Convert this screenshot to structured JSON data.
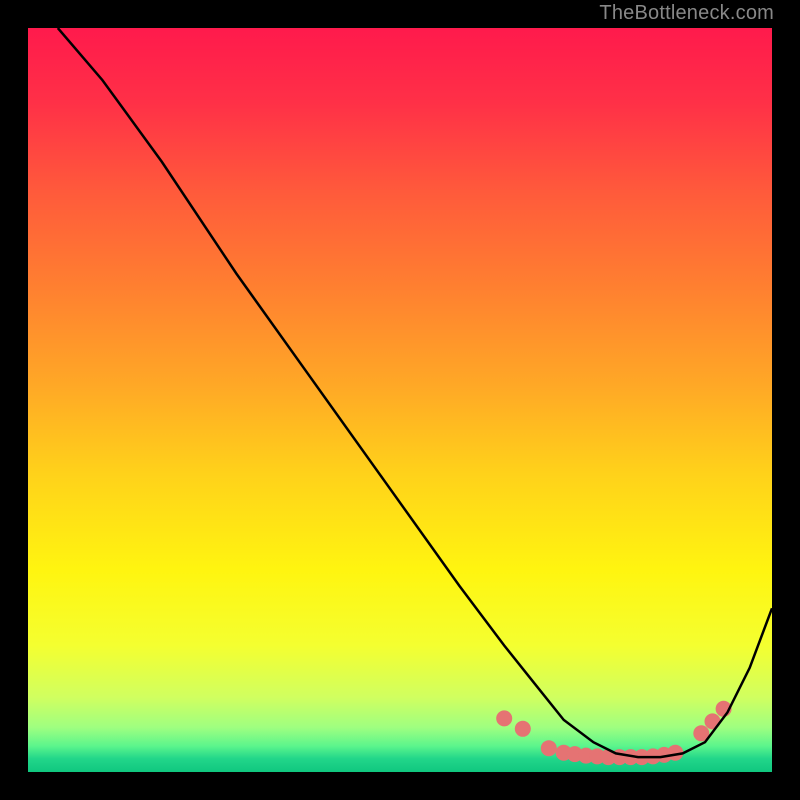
{
  "watermark": "TheBottleneck.com",
  "chart_data": {
    "type": "line",
    "title": "",
    "xlabel": "",
    "ylabel": "",
    "xlim": [
      0,
      100
    ],
    "ylim": [
      0,
      100
    ],
    "background": {
      "type": "vertical-gradient",
      "stops": [
        {
          "pos": 0.0,
          "color": "#ff1a4c"
        },
        {
          "pos": 0.1,
          "color": "#ff3047"
        },
        {
          "pos": 0.22,
          "color": "#ff5a3b"
        },
        {
          "pos": 0.35,
          "color": "#ff8030"
        },
        {
          "pos": 0.48,
          "color": "#ffa826"
        },
        {
          "pos": 0.6,
          "color": "#ffd21a"
        },
        {
          "pos": 0.73,
          "color": "#fff510"
        },
        {
          "pos": 0.83,
          "color": "#f4ff30"
        },
        {
          "pos": 0.9,
          "color": "#d0ff60"
        },
        {
          "pos": 0.94,
          "color": "#9fff80"
        },
        {
          "pos": 0.965,
          "color": "#5cf58c"
        },
        {
          "pos": 0.982,
          "color": "#22d68a"
        },
        {
          "pos": 1.0,
          "color": "#10c77f"
        }
      ]
    },
    "series": [
      {
        "name": "bottleneck-curve",
        "color": "#000000",
        "x": [
          4,
          10,
          18,
          28,
          38,
          48,
          58,
          64,
          68,
          72,
          76,
          79,
          82,
          85,
          88,
          91,
          94,
          97,
          100
        ],
        "y": [
          100,
          93,
          82,
          67,
          53,
          39,
          25,
          17,
          12,
          7,
          4,
          2.5,
          2,
          2,
          2.5,
          4,
          8,
          14,
          22
        ]
      }
    ],
    "markers": {
      "name": "optimal-zone-dots",
      "color": "#e57373",
      "radius": 8,
      "points": [
        {
          "x": 64,
          "y": 7.2
        },
        {
          "x": 66.5,
          "y": 5.8
        },
        {
          "x": 70,
          "y": 3.2
        },
        {
          "x": 72,
          "y": 2.6
        },
        {
          "x": 73.5,
          "y": 2.4
        },
        {
          "x": 75,
          "y": 2.2
        },
        {
          "x": 76.5,
          "y": 2.1
        },
        {
          "x": 78,
          "y": 2.0
        },
        {
          "x": 79.5,
          "y": 2.0
        },
        {
          "x": 81,
          "y": 2.0
        },
        {
          "x": 82.5,
          "y": 2.0
        },
        {
          "x": 84,
          "y": 2.1
        },
        {
          "x": 85.5,
          "y": 2.3
        },
        {
          "x": 87,
          "y": 2.6
        },
        {
          "x": 90.5,
          "y": 5.2
        },
        {
          "x": 92,
          "y": 6.8
        },
        {
          "x": 93.5,
          "y": 8.5
        }
      ]
    }
  }
}
